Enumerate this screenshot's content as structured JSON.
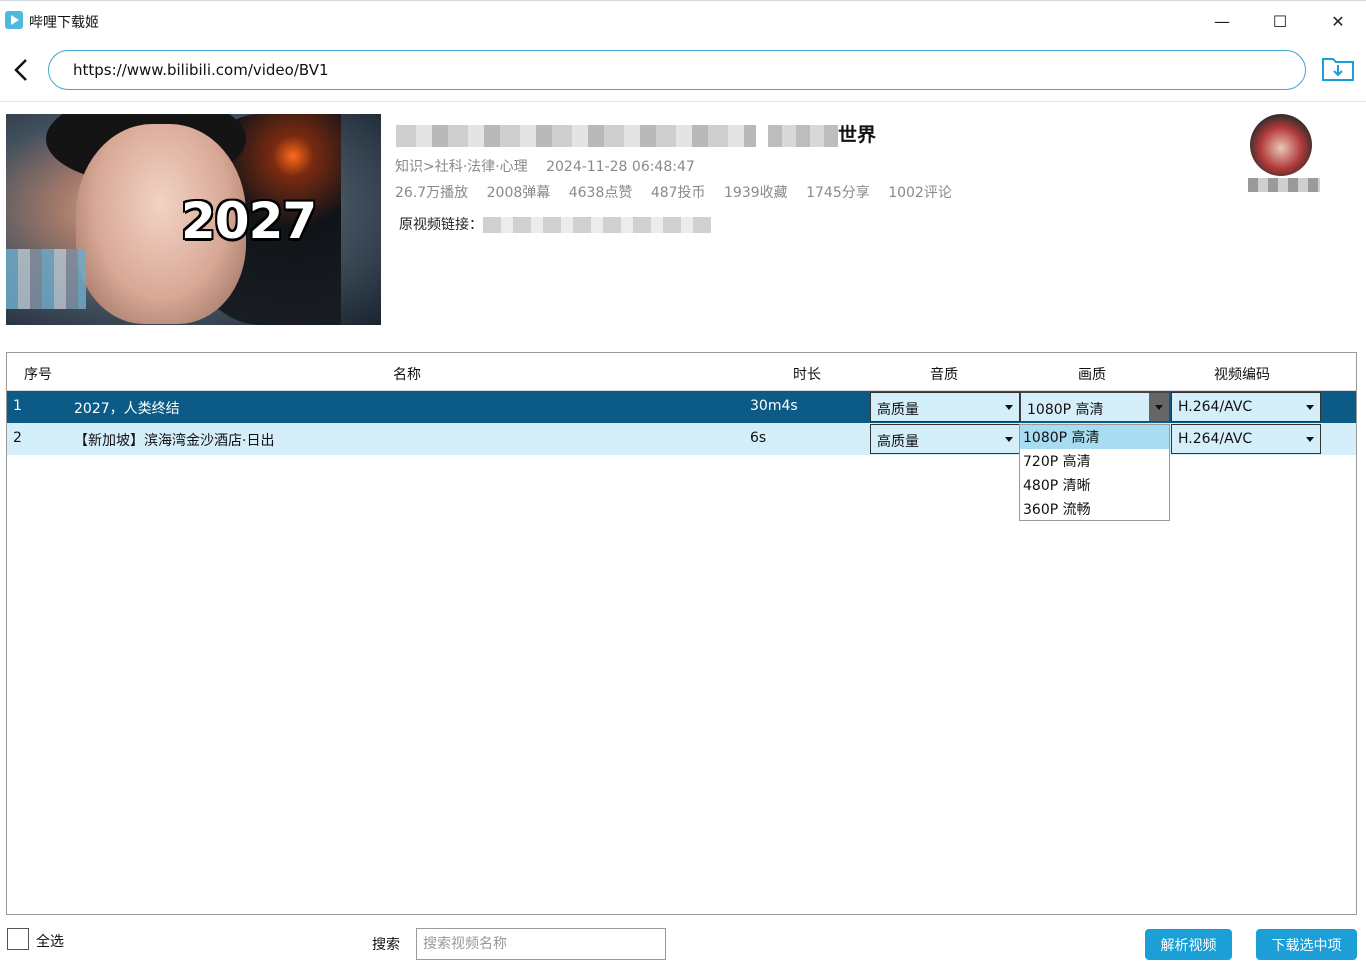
{
  "window": {
    "title": "哔哩下载姬",
    "minimize_glyph": "—",
    "maximize_glyph": "☐",
    "close_glyph": "✕"
  },
  "url_bar": {
    "value": "https://www.bilibili.com/video/BV1"
  },
  "video": {
    "thumbnail_text": "2027",
    "title_visible": "世界",
    "category": "知识>社科·法律·心理",
    "published": "2024-11-28 06:48:47",
    "stats": [
      "26.7万播放",
      "2008弹幕",
      "4638点赞",
      "487投币",
      "1939收藏",
      "1745分享",
      "1002评论"
    ],
    "source_label": "原视频链接："
  },
  "table": {
    "headers": {
      "index": "序号",
      "name": "名称",
      "duration": "时长",
      "audio_quality": "音质",
      "video_quality": "画质",
      "codec": "视频编码"
    },
    "rows": [
      {
        "index": "1",
        "name": "2027，人类终结",
        "duration": "30m4s",
        "audio": "高质量",
        "quality": "1080P 高清",
        "codec": "H.264/AVC"
      },
      {
        "index": "2",
        "name": "【新加坡】滨海湾金沙酒店·日出",
        "duration": "6s",
        "audio": "高质量",
        "quality": "1080P 高清",
        "codec": "H.264/AVC"
      }
    ],
    "quality_options": [
      "1080P 高清",
      "720P 高清",
      "480P 清晰",
      "360P 流畅"
    ]
  },
  "footer": {
    "select_all": "全选",
    "search_label": "搜索",
    "search_placeholder": "搜索视频名称",
    "parse_button": "解析视频",
    "download_button": "下载选中项"
  },
  "colors": {
    "accent": "#1b9fd6",
    "selected_row": "#0b5b86",
    "alt_row": "#d4eefa"
  }
}
